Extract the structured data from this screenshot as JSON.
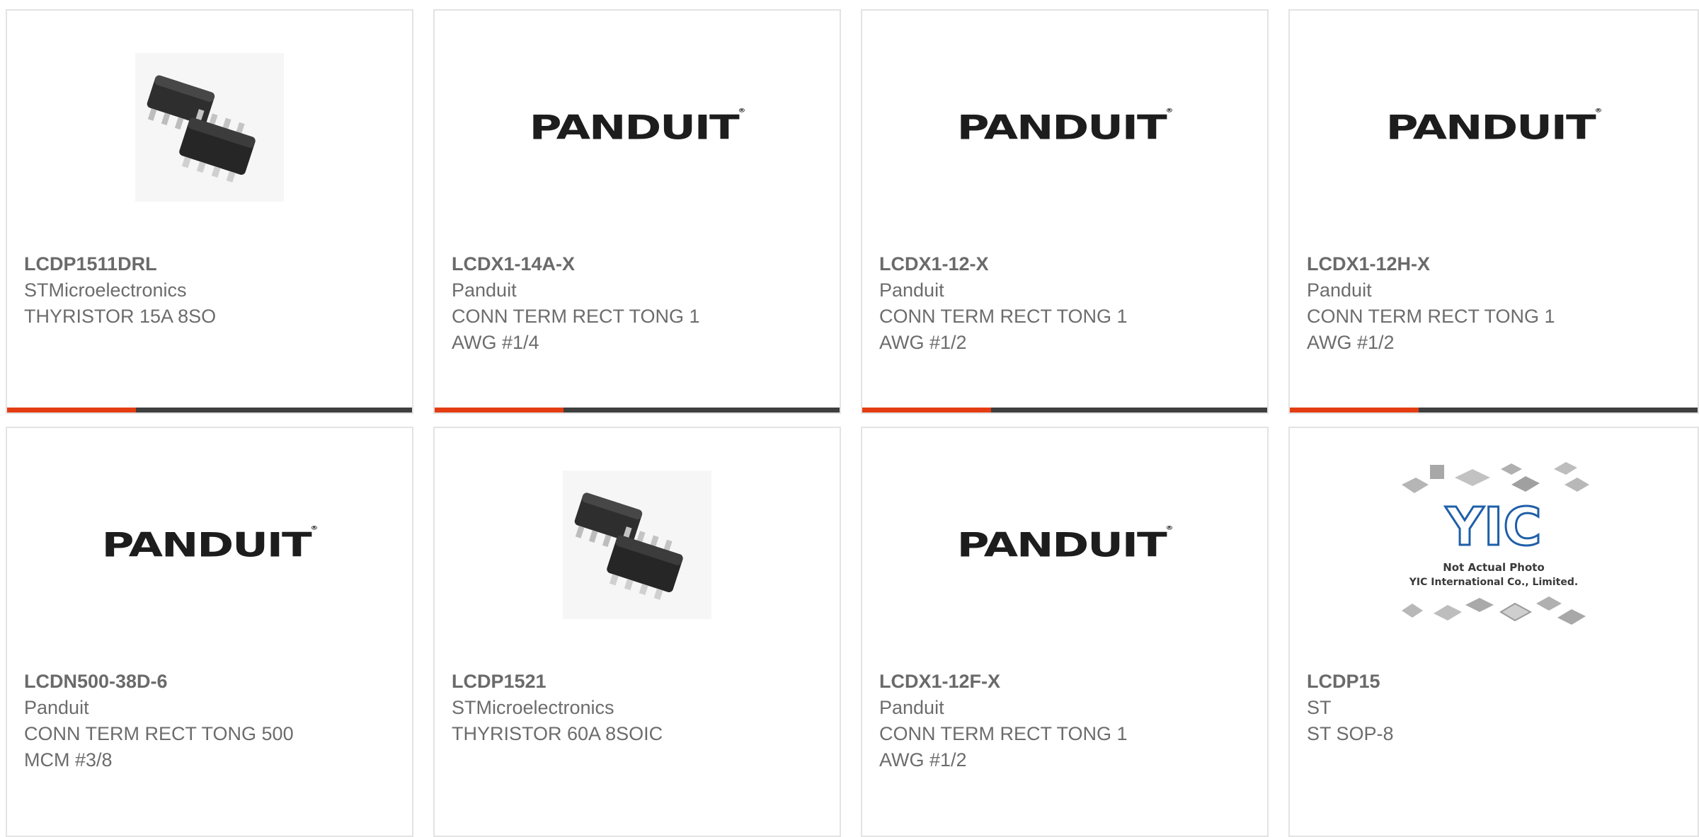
{
  "colors": {
    "accent": "#e43d12",
    "bar": "#3f3f3f",
    "card_border": "#e3e3e3",
    "text": "#6c6c6c"
  },
  "logos": {
    "panduit": "PANDUIT",
    "panduit_reg": "®",
    "yic_mark": "YIC",
    "yic_line1": "Not Actual Photo",
    "yic_line2": "YIC International Co., Limited."
  },
  "products": [
    {
      "part_number": "LCDP1511DRL",
      "manufacturer": "STMicroelectronics",
      "description_line1": "THYRISTOR 15A 8SO",
      "description_line2": "",
      "image": "ic-chip-icon"
    },
    {
      "part_number": "LCDX1-14A-X",
      "manufacturer": "Panduit",
      "description_line1": "CONN TERM RECT TONG 1",
      "description_line2": "AWG #1/4",
      "image": "panduit-logo"
    },
    {
      "part_number": "LCDX1-12-X",
      "manufacturer": "Panduit",
      "description_line1": "CONN TERM RECT TONG 1",
      "description_line2": "AWG #1/2",
      "image": "panduit-logo"
    },
    {
      "part_number": "LCDX1-12H-X",
      "manufacturer": "Panduit",
      "description_line1": "CONN TERM RECT TONG 1",
      "description_line2": "AWG #1/2",
      "image": "panduit-logo"
    },
    {
      "part_number": "LCDN500-38D-6",
      "manufacturer": "Panduit",
      "description_line1": "CONN TERM RECT TONG 500",
      "description_line2": "MCM #3/8",
      "image": "panduit-logo"
    },
    {
      "part_number": "LCDP1521",
      "manufacturer": "STMicroelectronics",
      "description_line1": "THYRISTOR 60A 8SOIC",
      "description_line2": "",
      "image": "ic-chip-icon"
    },
    {
      "part_number": "LCDX1-12F-X",
      "manufacturer": "Panduit",
      "description_line1": "CONN TERM RECT TONG 1",
      "description_line2": "AWG #1/2",
      "image": "panduit-logo"
    },
    {
      "part_number": "LCDP15",
      "manufacturer": "ST",
      "description_line1": "ST SOP-8",
      "description_line2": "",
      "image": "yic-placeholder"
    }
  ]
}
